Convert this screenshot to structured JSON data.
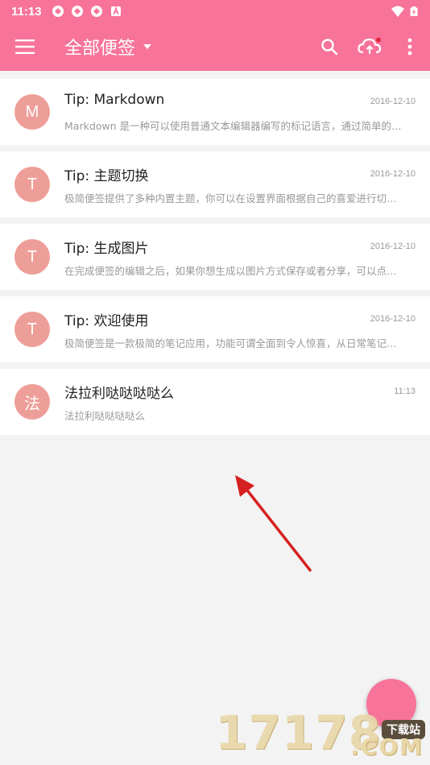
{
  "status": {
    "time": "11:13",
    "icons": [
      "sync-icon",
      "sync-icon",
      "sync-icon",
      "a-icon"
    ],
    "right_icons": [
      "wifi-icon",
      "battery-icon"
    ]
  },
  "appbar": {
    "title": "全部便签",
    "color": "#f7739a"
  },
  "notes": [
    {
      "avatar": "M",
      "title": "Tip: Markdown",
      "date": "2016-12-10",
      "preview": "Markdown 是一种可以使用普通文本编辑器编写的标记语言，通过简单的…"
    },
    {
      "avatar": "T",
      "title": "Tip: 主题切换",
      "date": "2016-12-10",
      "preview": "极简便签提供了多种内置主题，你可以在设置界面根据自己的喜爱进行切…"
    },
    {
      "avatar": "T",
      "title": "Tip: 生成图片",
      "date": "2016-12-10",
      "preview": "在完成便签的编辑之后，如果你想生成以图片方式保存或者分享，可以点…"
    },
    {
      "avatar": "T",
      "title": "Tip: 欢迎使用",
      "date": "2016-12-10",
      "preview": "极简便签是一款极简的笔记应用，功能可谓全面到令人惊喜，从日常笔记…"
    },
    {
      "avatar": "法",
      "title": "法拉利哒哒哒哒么",
      "date": "11:13",
      "preview": "法拉利哒哒哒哒么"
    }
  ],
  "watermark": {
    "number": "17178",
    "badge": "下载站",
    "domain": ".COM"
  },
  "colors": {
    "accent": "#f7739a",
    "avatar": "#ee9e98",
    "annotation_arrow": "#d62020"
  }
}
